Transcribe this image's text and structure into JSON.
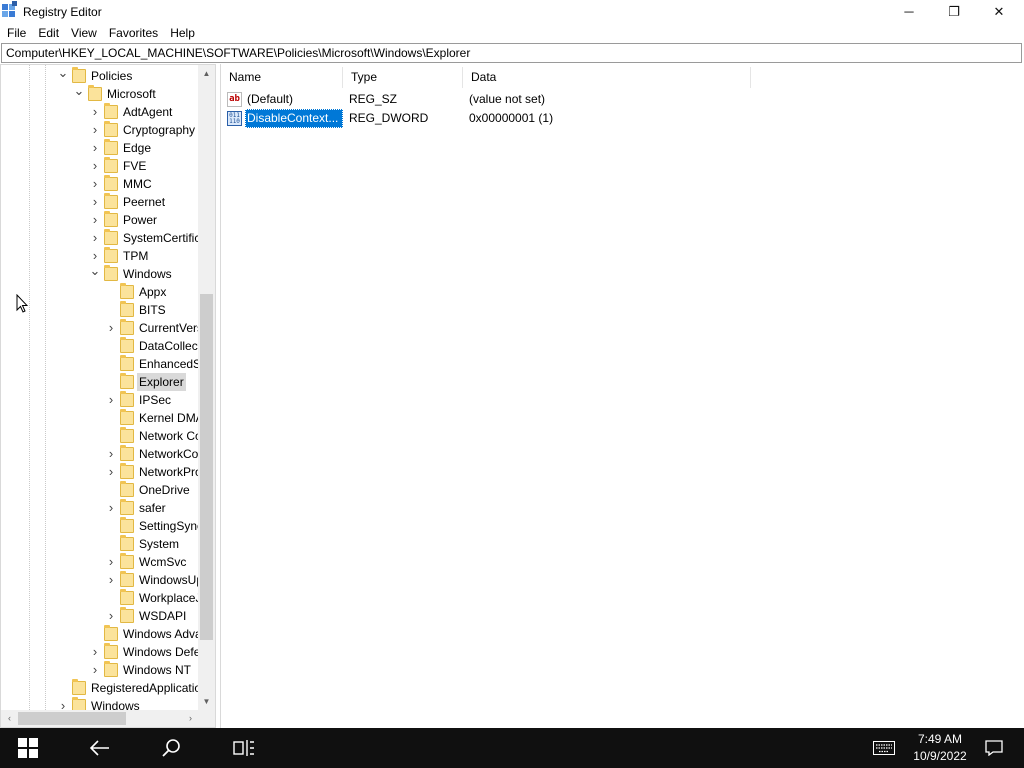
{
  "window": {
    "title": "Registry Editor",
    "controls": {
      "minimize": "─",
      "maximize": "❐",
      "close": "✕"
    }
  },
  "menu": [
    "File",
    "Edit",
    "View",
    "Favorites",
    "Help"
  ],
  "address": "Computer\\HKEY_LOCAL_MACHINE\\SOFTWARE\\Policies\\Microsoft\\Windows\\Explorer",
  "tree": {
    "items": [
      {
        "label": "Policies",
        "depth": 0,
        "expanded": true,
        "has_children": true
      },
      {
        "label": "Microsoft",
        "depth": 1,
        "expanded": true,
        "has_children": true
      },
      {
        "label": "AdtAgent",
        "depth": 2,
        "has_children": true
      },
      {
        "label": "Cryptography",
        "depth": 2,
        "has_children": true
      },
      {
        "label": "Edge",
        "depth": 2,
        "has_children": true
      },
      {
        "label": "FVE",
        "depth": 2,
        "has_children": true
      },
      {
        "label": "MMC",
        "depth": 2,
        "has_children": true
      },
      {
        "label": "Peernet",
        "depth": 2,
        "has_children": true
      },
      {
        "label": "Power",
        "depth": 2,
        "has_children": true
      },
      {
        "label": "SystemCertific",
        "depth": 2,
        "has_children": true
      },
      {
        "label": "TPM",
        "depth": 2,
        "has_children": true
      },
      {
        "label": "Windows",
        "depth": 2,
        "expanded": true,
        "has_children": true
      },
      {
        "label": "Appx",
        "depth": 3,
        "has_children": false
      },
      {
        "label": "BITS",
        "depth": 3,
        "has_children": false
      },
      {
        "label": "CurrentVers",
        "depth": 3,
        "has_children": true
      },
      {
        "label": "DataCollect",
        "depth": 3,
        "has_children": false
      },
      {
        "label": "EnhancedSt",
        "depth": 3,
        "has_children": false
      },
      {
        "label": "Explorer",
        "depth": 3,
        "has_children": false,
        "selected": true
      },
      {
        "label": "IPSec",
        "depth": 3,
        "has_children": true
      },
      {
        "label": "Kernel DMA",
        "depth": 3,
        "has_children": false
      },
      {
        "label": "Network Co",
        "depth": 3,
        "has_children": false
      },
      {
        "label": "NetworkCo",
        "depth": 3,
        "has_children": true
      },
      {
        "label": "NetworkPro",
        "depth": 3,
        "has_children": true
      },
      {
        "label": "OneDrive",
        "depth": 3,
        "has_children": false
      },
      {
        "label": "safer",
        "depth": 3,
        "has_children": true
      },
      {
        "label": "SettingSync",
        "depth": 3,
        "has_children": false
      },
      {
        "label": "System",
        "depth": 3,
        "has_children": false
      },
      {
        "label": "WcmSvc",
        "depth": 3,
        "has_children": true
      },
      {
        "label": "WindowsUp",
        "depth": 3,
        "has_children": true
      },
      {
        "label": "WorkplaceJ",
        "depth": 3,
        "has_children": false
      },
      {
        "label": "WSDAPI",
        "depth": 3,
        "has_children": true
      },
      {
        "label": "Windows Adva",
        "depth": 2,
        "has_children": false
      },
      {
        "label": "Windows Defe",
        "depth": 2,
        "has_children": true
      },
      {
        "label": "Windows NT",
        "depth": 2,
        "has_children": true
      },
      {
        "label": "RegisteredApplicatio",
        "depth": 0,
        "has_children": false
      },
      {
        "label": "Windows",
        "depth": 0,
        "has_children": true
      }
    ]
  },
  "values": {
    "columns": [
      "Name",
      "Type",
      "Data"
    ],
    "rows": [
      {
        "name": "(Default)",
        "type": "REG_SZ",
        "data": "(value not set)",
        "icon": "string-value-icon",
        "icon_text": "ab"
      },
      {
        "name": "DisableContext...",
        "type": "REG_DWORD",
        "data": "0x00000001 (1)",
        "icon": "binary-value-icon",
        "icon_text": "011 110",
        "selected": true
      }
    ]
  },
  "taskbar": {
    "time": "7:49 AM",
    "date": "10/9/2022"
  },
  "colors": {
    "selection": "#0078d7",
    "taskbar": "#101010",
    "folder": "#fbe39b"
  }
}
